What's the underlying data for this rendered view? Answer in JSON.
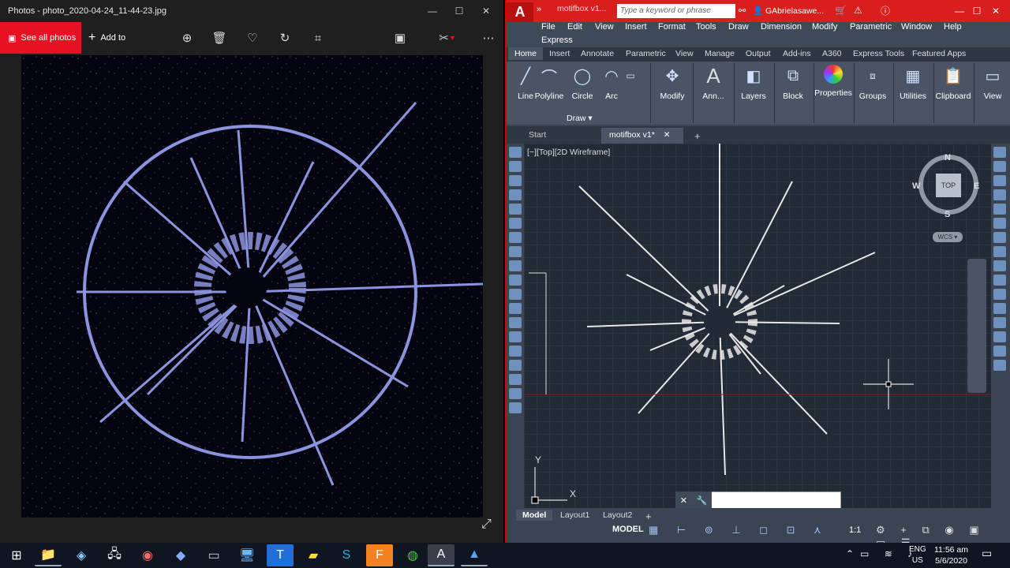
{
  "photos": {
    "title": "Photos - photo_2020-04-24_11-44-23.jpg",
    "see_all_label": "See all photos",
    "add_to_label": "Add to",
    "toolbar_icons": [
      "zoom-icon",
      "delete-icon",
      "heart-icon",
      "rotate-icon",
      "crop-icon",
      "slideshow-icon",
      "edit-icon",
      "more-icon"
    ]
  },
  "acad": {
    "tab_title": "motifbox v1...",
    "search_placeholder": "Type a keyword or phrase",
    "user": "GAbrielasawe...",
    "menu": [
      "File",
      "Edit",
      "View",
      "Insert",
      "Format",
      "Tools",
      "Draw",
      "Dimension",
      "Modify",
      "Parametric",
      "Window",
      "Help",
      "Express"
    ],
    "ribbon_tabs": [
      "Home",
      "Insert",
      "Annotate",
      "Parametric",
      "View",
      "Manage",
      "Output",
      "Add-ins",
      "A360",
      "Express Tools",
      "Featured Apps"
    ],
    "ribbon_buttons": [
      "Line",
      "Polyline",
      "Circle",
      "Arc",
      "Modify",
      "Ann...",
      "Layers",
      "Block",
      "Properties",
      "Groups",
      "Utilities",
      "Clipboard",
      "View"
    ],
    "draw_panel": "Draw",
    "doc_tabs": [
      "Start",
      "motifbox v1*"
    ],
    "viewport_label": "[−][Top][2D Wireframe]",
    "viewcube": {
      "n": "N",
      "s": "S",
      "e": "E",
      "w": "W",
      "top": "TOP",
      "wcs": "WCS"
    },
    "ucs": {
      "x": "X",
      "y": "Y"
    },
    "layout_tabs": [
      "Model",
      "Layout1",
      "Layout2"
    ],
    "status_model": "MODEL",
    "status_scale": "1:1"
  },
  "taskbar": {
    "apps": [
      "windows-icon",
      "file-explorer-icon",
      "app-icon",
      "network-icon",
      "media-icon",
      "vs-icon",
      "terminal-icon",
      "remote-icon",
      "typora-icon",
      "sticky-icon",
      "skype-icon",
      "fusion-icon",
      "chrome-icon",
      "autocad-icon",
      "photos-icon"
    ],
    "lang1": "ENG",
    "lang2": "US",
    "time": "11:56 am",
    "date": "5/6/2020"
  }
}
